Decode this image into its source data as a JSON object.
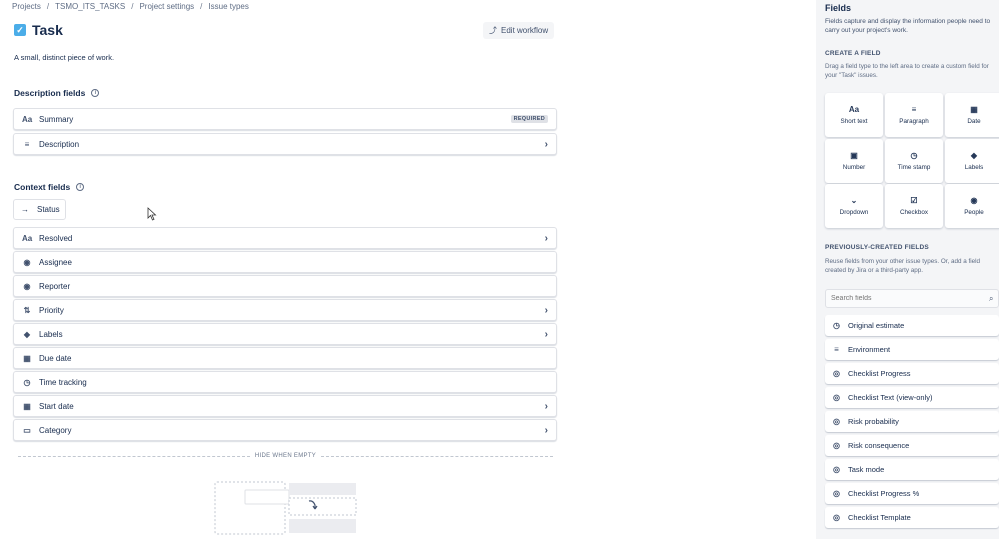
{
  "breadcrumb": {
    "items": [
      "Projects",
      "TSMO_ITS_TASKS",
      "Project settings",
      "Issue types"
    ],
    "sep": "/"
  },
  "header": {
    "title": "Task",
    "edit_workflow_label": "Edit workflow",
    "description": "A small, distinct piece of work."
  },
  "description_fields": {
    "title": "Description fields",
    "items": [
      {
        "label": "Summary",
        "icon": "Aa",
        "badge": "REQUIRED",
        "chevron": ""
      },
      {
        "label": "Description",
        "icon": "≡",
        "badge": "",
        "chevron": "›"
      }
    ]
  },
  "context_fields": {
    "title": "Context fields",
    "status_label": "Status",
    "items": [
      {
        "label": "Resolved",
        "icon": "Aa",
        "chevron": "›"
      },
      {
        "label": "Assignee",
        "icon": "◉",
        "chevron": ""
      },
      {
        "label": "Reporter",
        "icon": "◉",
        "chevron": ""
      },
      {
        "label": "Priority",
        "icon": "⇅",
        "chevron": "›"
      },
      {
        "label": "Labels",
        "icon": "◆",
        "chevron": "›"
      },
      {
        "label": "Due date",
        "icon": "▦",
        "chevron": ""
      },
      {
        "label": "Time tracking",
        "icon": "◷",
        "chevron": ""
      },
      {
        "label": "Start date",
        "icon": "▦",
        "chevron": "›"
      },
      {
        "label": "Category",
        "icon": "▭",
        "chevron": "›"
      }
    ]
  },
  "hide_when_empty": "HIDE WHEN EMPTY",
  "panel": {
    "title": "Fields",
    "description": "Fields capture and display the information people need to carry out your project's work.",
    "create_heading": "CREATE A FIELD",
    "create_desc": "Drag a field type to the left area to create a custom field for your \"Task\" issues.",
    "tiles": [
      {
        "label": "Short text",
        "icon": "Aa"
      },
      {
        "label": "Paragraph",
        "icon": "≡"
      },
      {
        "label": "Date",
        "icon": "▦"
      },
      {
        "label": "Number",
        "icon": "▣"
      },
      {
        "label": "Time stamp",
        "icon": "◷"
      },
      {
        "label": "Labels",
        "icon": "◆"
      },
      {
        "label": "Dropdown",
        "icon": "⌄"
      },
      {
        "label": "Checkbox",
        "icon": "☑"
      },
      {
        "label": "People",
        "icon": "◉"
      }
    ],
    "prev_heading": "PREVIOUSLY-CREATED FIELDS",
    "prev_desc": "Reuse fields from your other issue types. Or, add a field created by Jira or a third-party app.",
    "search_placeholder": "Search fields",
    "prev_fields": [
      {
        "label": "Original estimate",
        "icon": "◷"
      },
      {
        "label": "Environment",
        "icon": "≡"
      },
      {
        "label": "Checklist Progress",
        "icon": "◎"
      },
      {
        "label": "Checklist Text (view-only)",
        "icon": "◎"
      },
      {
        "label": "Risk probability",
        "icon": "◎"
      },
      {
        "label": "Risk consequence",
        "icon": "◎"
      },
      {
        "label": "Task mode",
        "icon": "◎"
      },
      {
        "label": "Checklist Progress %",
        "icon": "◎"
      },
      {
        "label": "Checklist Template",
        "icon": "◎"
      }
    ]
  }
}
